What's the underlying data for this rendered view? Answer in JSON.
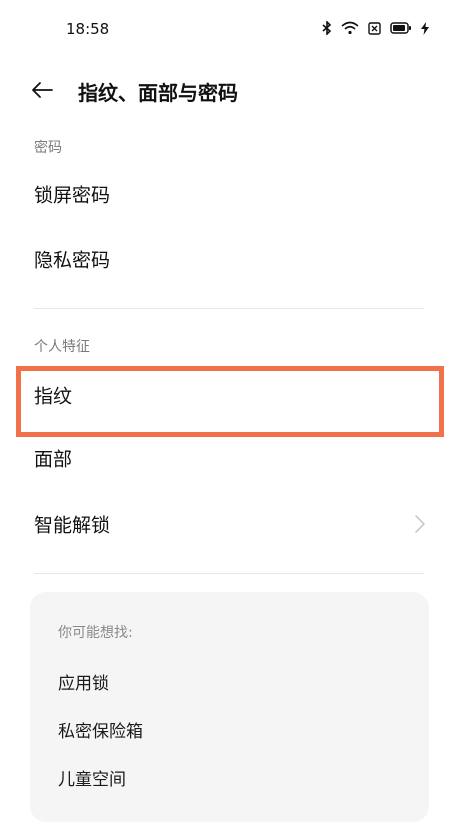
{
  "status_bar": {
    "time": "18:58",
    "icons": [
      "bluetooth-icon",
      "wifi-icon",
      "sim-icon",
      "battery-icon",
      "charging-icon"
    ]
  },
  "header": {
    "title": "指纹、面部与密码"
  },
  "sections": {
    "password": {
      "header": "密码",
      "items": [
        {
          "label": "锁屏密码"
        },
        {
          "label": "隐私密码"
        }
      ]
    },
    "personal": {
      "header": "个人特征",
      "items": [
        {
          "label": "指纹",
          "highlighted": true
        },
        {
          "label": "面部"
        },
        {
          "label": "智能解锁",
          "has_chevron": true
        }
      ]
    }
  },
  "suggestions": {
    "title": "你可能想找:",
    "items": [
      "应用锁",
      "私密保险箱",
      "儿童空间"
    ]
  },
  "colors": {
    "highlight": "#f2704a",
    "card_bg": "#f5f5f5",
    "secondary_text": "#7a7a7a"
  }
}
